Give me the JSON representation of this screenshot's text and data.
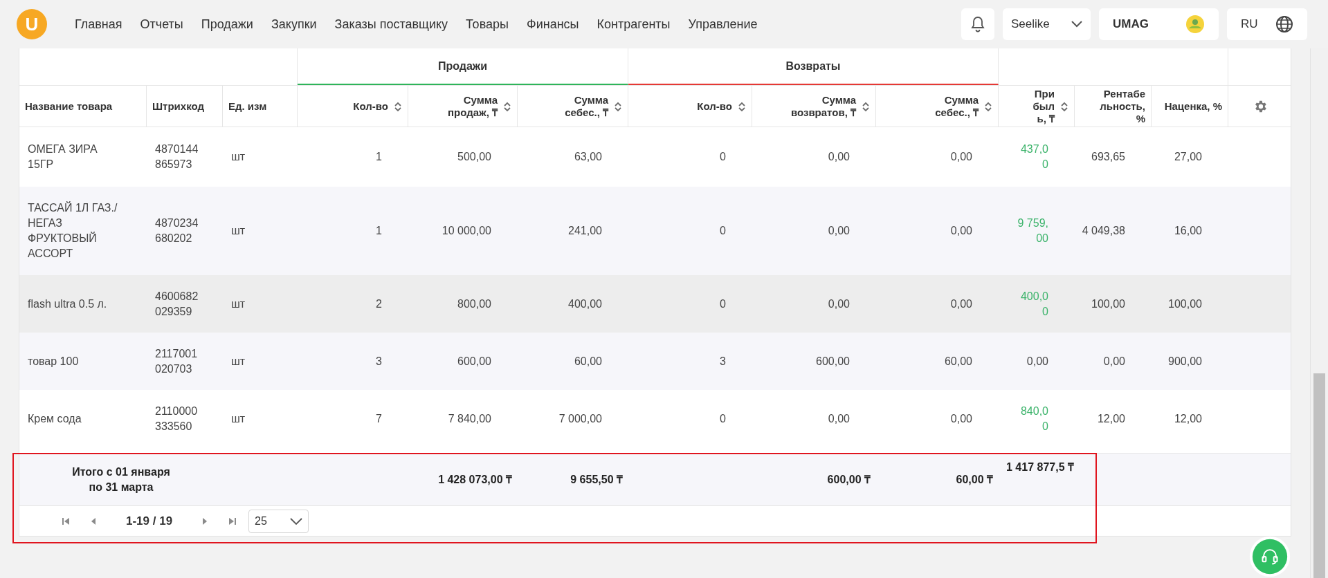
{
  "logo": "U",
  "nav": [
    "Главная",
    "Отчеты",
    "Продажи",
    "Закупки",
    "Заказы поставщику",
    "Товары",
    "Финансы",
    "Контрагенты",
    "Управление"
  ],
  "company": "Seelike",
  "account": "UMAG",
  "language": "RU",
  "table": {
    "groups": [
      {
        "label": "Продажи",
        "color": "#2fb45a"
      },
      {
        "label": "Возвраты",
        "color": "#e53935"
      }
    ],
    "columns": [
      {
        "label": "Название товара",
        "sortable": false,
        "kind": "text"
      },
      {
        "label": "Штрихкод",
        "sortable": false,
        "kind": "code"
      },
      {
        "label": "Ед. изм",
        "sortable": false,
        "kind": "text"
      },
      {
        "label": "Кол-во",
        "sortable": true,
        "kind": "number"
      },
      {
        "label": "Сумма продаж, ₸",
        "sortable": true,
        "kind": "number"
      },
      {
        "label": "Сумма себес., ₸",
        "sortable": true,
        "kind": "number"
      },
      {
        "label": "Кол-во",
        "sortable": true,
        "kind": "number"
      },
      {
        "label": "Сумма возвратов, ₸",
        "sortable": true,
        "kind": "number"
      },
      {
        "label": "Сумма себес., ₸",
        "sortable": true,
        "kind": "number"
      },
      {
        "label": "Прибыль, ₸",
        "sortable": true,
        "kind": "narrow"
      },
      {
        "label": "Рентабельность, %",
        "sortable": false,
        "kind": "narrow"
      },
      {
        "label": "Наценка, %",
        "sortable": false,
        "kind": "number"
      }
    ],
    "rows": [
      {
        "highlighted": false,
        "profit_positive": true,
        "cells": [
          "ОМЕГА ЗИРА 15ГР",
          "4870144865973",
          "шт",
          "1",
          "500,00",
          "63,00",
          "0",
          "0,00",
          "0,00",
          "437,00",
          "693,65",
          "27,00"
        ]
      },
      {
        "highlighted": false,
        "profit_positive": true,
        "cells": [
          "ТАССАЙ 1Л ГАЗ./ НЕГАЗ ФРУКТОВЫЙ АССОРТ",
          "4870234680202",
          "шт",
          "1",
          "10 000,00",
          "241,00",
          "0",
          "0,00",
          "0,00",
          "9 759,00",
          "4 049,38",
          "16,00"
        ]
      },
      {
        "highlighted": true,
        "profit_positive": true,
        "cells": [
          "flash ultra 0.5 л.",
          "4600682029359",
          "шт",
          "2",
          "800,00",
          "400,00",
          "0",
          "0,00",
          "0,00",
          "400,00",
          "100,00",
          "100,00"
        ]
      },
      {
        "highlighted": false,
        "profit_positive": false,
        "cells": [
          "товар 100",
          "2117001020703",
          "шт",
          "3",
          "600,00",
          "60,00",
          "3",
          "600,00",
          "60,00",
          "0,00",
          "0,00",
          "900,00"
        ]
      },
      {
        "highlighted": false,
        "profit_positive": true,
        "cells": [
          "Крем сода",
          "2110000333560",
          "шт",
          "7",
          "7 840,00",
          "7 000,00",
          "0",
          "0,00",
          "0,00",
          "840,00",
          "12,00",
          "12,00"
        ]
      }
    ],
    "totals": {
      "label": "Итого с 01 января по 31 марта",
      "sales_sum": "1 428 073,00 ₸",
      "sales_cost": "9 655,50 ₸",
      "returns_sum": "600,00 ₸",
      "returns_cost": "60,00 ₸",
      "profit": "1 417 877,5 ₸"
    }
  },
  "pagination": {
    "range": "1-19 / 19",
    "page_size": "25"
  }
}
